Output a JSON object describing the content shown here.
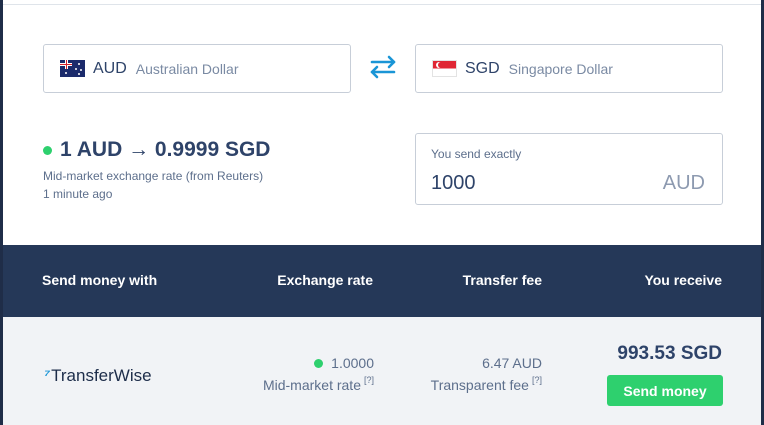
{
  "colors": {
    "brand_navy": "#253858",
    "text_navy": "#2e4369",
    "accent_green": "#2ed06e",
    "accent_blue": "#1a95d6",
    "row_bg": "#f1f3f6"
  },
  "converter": {
    "from": {
      "code": "AUD",
      "name": "Australian Dollar",
      "flag_icon": "australia-flag-icon"
    },
    "to": {
      "code": "SGD",
      "name": "Singapore Dollar",
      "flag_icon": "singapore-flag-icon"
    },
    "swap_icon": "swap-arrows-icon",
    "rate_text": "1 AUD → 0.9999 SGD",
    "rate_source": "Mid-market exchange rate (from Reuters)",
    "rate_updated": "1 minute ago",
    "send_label": "You send exactly",
    "send_amount": "1000",
    "send_currency": "AUD"
  },
  "table": {
    "headers": [
      "Send money with",
      "Exchange rate",
      "Transfer fee",
      "You receive"
    ],
    "rows": [
      {
        "provider": "TransferWise",
        "provider_logo_glyph": "⁷",
        "rate": "1.0000",
        "rate_caption": "Mid-market rate",
        "rate_hint": "[?]",
        "fee": "6.47 AUD",
        "fee_caption": "Transparent fee",
        "fee_hint": "[?]",
        "receive": "993.53 SGD",
        "button_label": "Send money"
      }
    ]
  }
}
